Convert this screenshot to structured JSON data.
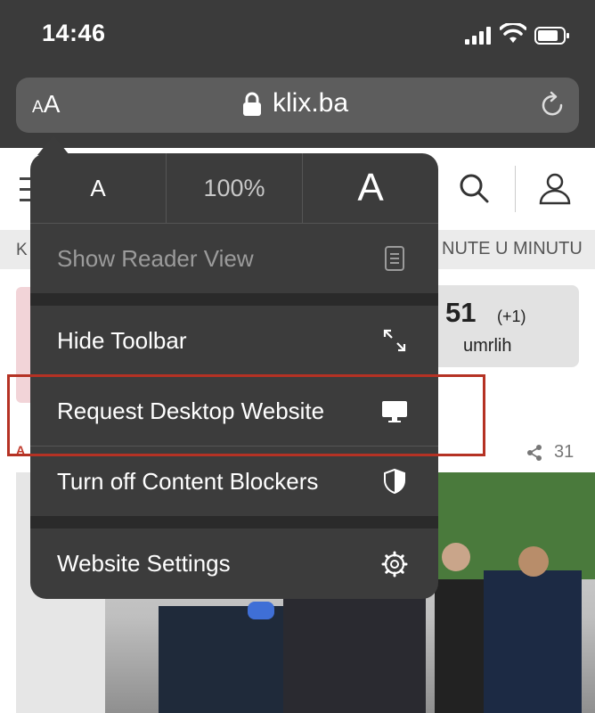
{
  "status_bar": {
    "time": "14:46"
  },
  "address_bar": {
    "text_size_button": "AA",
    "url": "klix.ba"
  },
  "page": {
    "ticker_left": "K",
    "ticker_right": "NUTE U MINUTU",
    "stat_number": "51",
    "stat_delta": "(+1)",
    "stat_label": "umrlih",
    "article_tag": "A",
    "share_count": "31"
  },
  "menu": {
    "font_small": "A",
    "zoom": "100%",
    "font_large": "A",
    "items": [
      {
        "label": "Show Reader View",
        "icon": "reader-icon",
        "enabled": false
      },
      {
        "label": "Hide Toolbar",
        "icon": "resize-arrows-icon",
        "enabled": true
      },
      {
        "label": "Request Desktop Website",
        "icon": "desktop-icon",
        "enabled": true
      },
      {
        "label": "Turn off Content Blockers",
        "icon": "shield-icon",
        "enabled": true
      },
      {
        "label": "Website Settings",
        "icon": "gear-icon",
        "enabled": true
      }
    ]
  },
  "colors": {
    "highlight": "#b53224",
    "menu_bg": "#3c3c3c"
  }
}
